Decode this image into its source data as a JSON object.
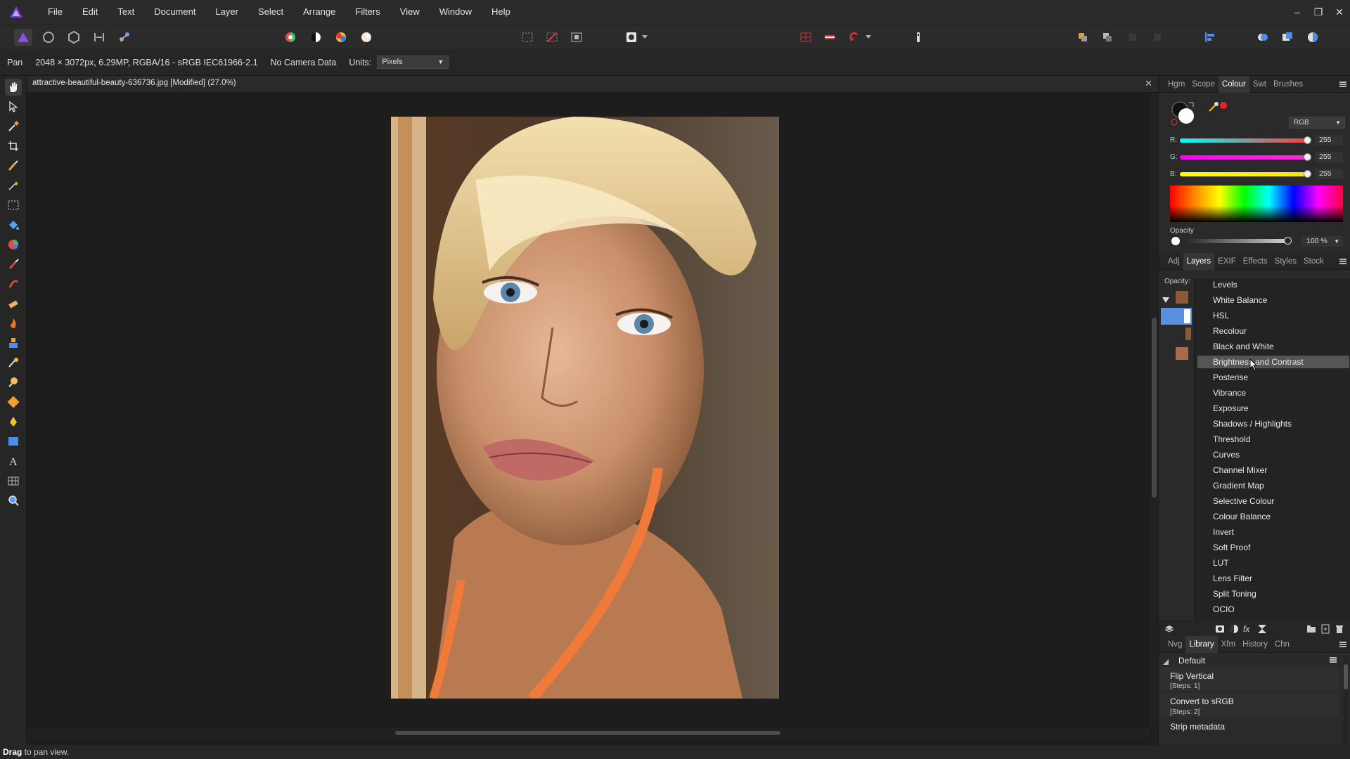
{
  "menu": {
    "items": [
      "File",
      "Edit",
      "Text",
      "Document",
      "Layer",
      "Select",
      "Arrange",
      "Filters",
      "View",
      "Window",
      "Help"
    ]
  },
  "window_controls": {
    "minimize": "–",
    "restore": "❐",
    "close": "✕"
  },
  "context_bar": {
    "tool": "Pan",
    "image_info": "2048 × 3072px, 6.29MP, RGBA/16 - sRGB IEC61966-2.1",
    "camera": "No Camera Data",
    "units_label": "Units:",
    "units_value": "Pixels"
  },
  "document": {
    "title": "attractive-beautiful-beauty-636736.jpg [Modified] (27.0%)",
    "close": "✕"
  },
  "colour_panel": {
    "tabs": [
      "Hgm",
      "Scope",
      "Colour",
      "Swt",
      "Brushes"
    ],
    "active_tab": "Colour",
    "mode": "RGB",
    "sliders": [
      {
        "label": "R:",
        "value": "255"
      },
      {
        "label": "G:",
        "value": "255"
      },
      {
        "label": "B:",
        "value": "255"
      }
    ],
    "opacity_label": "Opacity",
    "opacity_value": "100 %",
    "colors": {
      "r_track": "#ff3b3b",
      "g_track": "#ff2bd8",
      "b_track": "#ffe600",
      "accent": "#4a8fe7"
    }
  },
  "layers_panel": {
    "tabs": [
      "Adj",
      "Layers",
      "EXIF",
      "Effects",
      "Styles",
      "Stock"
    ],
    "active_tab": "Layers",
    "opacity_label": "Opacity:"
  },
  "adjustments_menu": {
    "items": [
      "Levels",
      "White Balance",
      "HSL",
      "Recolour",
      "Black and White",
      "Brightness and Contrast",
      "Posterise",
      "Vibrance",
      "Exposure",
      "Shadows / Highlights",
      "Threshold",
      "Curves",
      "Channel Mixer",
      "Gradient Map",
      "Selective Colour",
      "Colour Balance",
      "Invert",
      "Soft Proof",
      "LUT",
      "Lens Filter",
      "Split Toning",
      "OCIO"
    ],
    "highlighted": "Brightness and Contrast"
  },
  "library_panel": {
    "tabs": [
      "Nvg",
      "Library",
      "Xfm",
      "History",
      "Chn"
    ],
    "active_tab": "Library",
    "category": "Default",
    "macros": [
      {
        "name": "Flip Vertical",
        "steps": "[Steps: 1]"
      },
      {
        "name": "Convert to sRGB",
        "steps": "[Steps: 2]"
      },
      {
        "name": "Strip metadata",
        "steps": ""
      }
    ]
  },
  "status": {
    "bold": "Drag",
    "text": " to pan view."
  }
}
